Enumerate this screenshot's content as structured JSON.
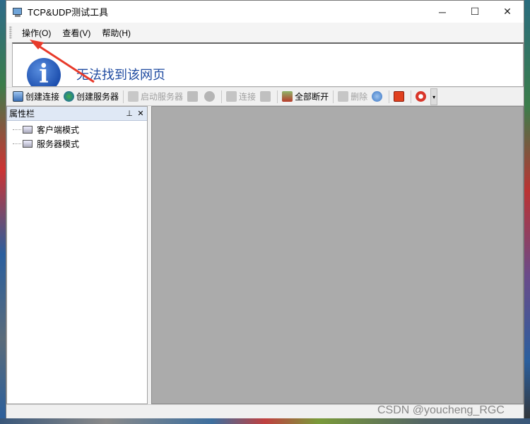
{
  "window": {
    "title": "TCP&UDP测试工具",
    "minimize": "─",
    "maximize": "☐",
    "close": "✕"
  },
  "menu": {
    "items": [
      {
        "label": "操作(O)"
      },
      {
        "label": "查看(V)"
      },
      {
        "label": "帮助(H)"
      }
    ]
  },
  "browser": {
    "message": "无法找到该网页",
    "info_glyph": "i"
  },
  "toolbar": {
    "create_connection": "创建连接",
    "create_server": "创建服务器",
    "start_server": "启动服务器",
    "connect": "连接",
    "disconnect_all": "全部断开",
    "delete": "删除"
  },
  "panel": {
    "title": "属性栏",
    "pin": "ᵖ",
    "close": "✕",
    "tree": [
      {
        "label": "客户端模式"
      },
      {
        "label": "服务器模式"
      }
    ]
  },
  "watermark": "CSDN @youcheng_RGC",
  "colors": {
    "annotation_arrow": "#e83a2a",
    "workspace": "#ababab",
    "panel_header": "#dfe8f5"
  }
}
